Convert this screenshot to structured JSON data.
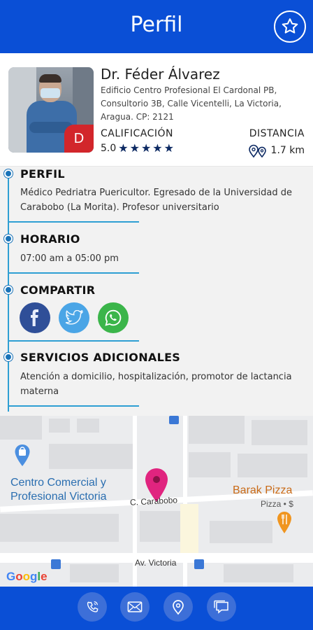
{
  "header": {
    "title": "Perfil",
    "favorite_icon": "star-outline-icon"
  },
  "doctor": {
    "name": "Dr. Féder Álvarez",
    "address": "Edificio Centro Profesional El Cardonal PB, Consultorio 3B, Calle Vicentelli, La Victoria, Aragua. CP: 2121",
    "badge_letter": "D",
    "rating_label": "CALIFICACIÓN",
    "rating_value": "5.0",
    "stars": 5,
    "distance_label": "DISTANCIA",
    "distance_value": "1.7 km"
  },
  "sections": {
    "perfil": {
      "title": "PERFIL",
      "text": "Médico Pedriatra Puericultor. Egresado de la Universidad de Carabobo (La Morita). Profesor universitario"
    },
    "horario": {
      "title": "HORARIO",
      "text": "07:00 am a 05:00 pm"
    },
    "compartir": {
      "title": "COMPARTIR",
      "networks": [
        "facebook-icon",
        "twitter-icon",
        "whatsapp-icon"
      ]
    },
    "servicios": {
      "title": "SERVICIOS ADICIONALES",
      "text": "Atención a domicilio, hospitalización, promotor de lactancia materna"
    }
  },
  "map": {
    "poi_centro_line1": "Centro Comercial y",
    "poi_centro_line2": "Profesional Victoria",
    "poi_barak": "Barak Pizza",
    "poi_barak_sub": "Pizza • $",
    "street_carabobo": "C. Carabobo",
    "street_victoria": "Av. Victoria",
    "google": "Google"
  },
  "footer": {
    "icons": [
      "phone-icon",
      "mail-icon",
      "location-pin-icon",
      "chat-icon"
    ]
  },
  "colors": {
    "primary": "#0a4fd6",
    "accent_line": "#2e9fd3",
    "star": "#0d2a63",
    "badge": "#d2262b"
  }
}
